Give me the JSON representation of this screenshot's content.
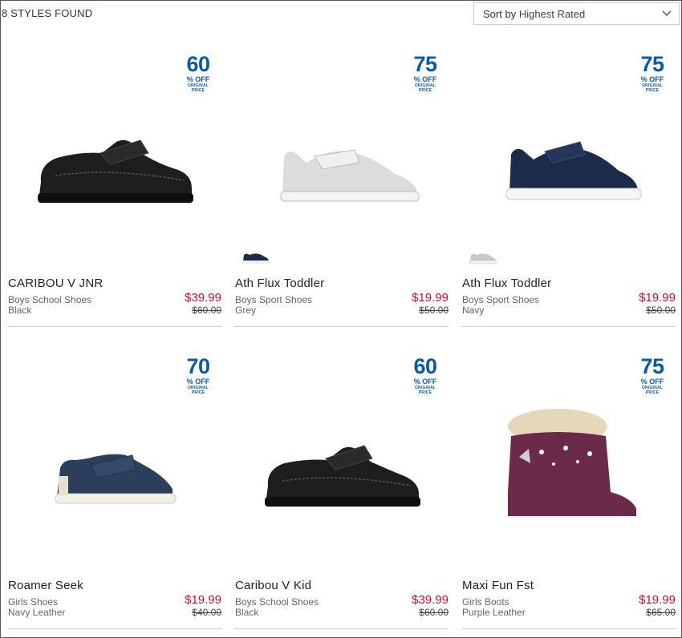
{
  "results": {
    "count_label": "8 STYLES FOUND"
  },
  "sort": {
    "label": "Sort by",
    "value": "Highest Rated"
  },
  "badge_text": {
    "off": "% OFF",
    "line1": "ORIGINAL",
    "line2": "PRICE"
  },
  "products": [
    {
      "name": "CARIBOU V JNR",
      "category": "Boys School Shoes",
      "color": "Black",
      "price": "$39.99",
      "original": "$60.00",
      "discount": "60"
    },
    {
      "name": "Ath Flux Toddler",
      "category": "Boys Sport Shoes",
      "color": "Grey",
      "price": "$19.99",
      "original": "$50.00",
      "discount": "75"
    },
    {
      "name": "Ath Flux Toddler",
      "category": "Boys Sport Shoes",
      "color": "Navy",
      "price": "$19.99",
      "original": "$50.00",
      "discount": "75"
    },
    {
      "name": "Roamer Seek",
      "category": "Girls Shoes",
      "color": "Navy Leather",
      "price": "$19.99",
      "original": "$40.00",
      "discount": "70"
    },
    {
      "name": "Caribou V Kid",
      "category": "Boys School Shoes",
      "color": "Black",
      "price": "$39.99",
      "original": "$60.00",
      "discount": "60"
    },
    {
      "name": "Maxi Fun Fst",
      "category": "Girls Boots",
      "color": "Purple Leather",
      "price": "$19.99",
      "original": "$65.00",
      "discount": "75"
    }
  ],
  "colors": {
    "price": "#c8102e",
    "badge": "#0a5aa6"
  }
}
